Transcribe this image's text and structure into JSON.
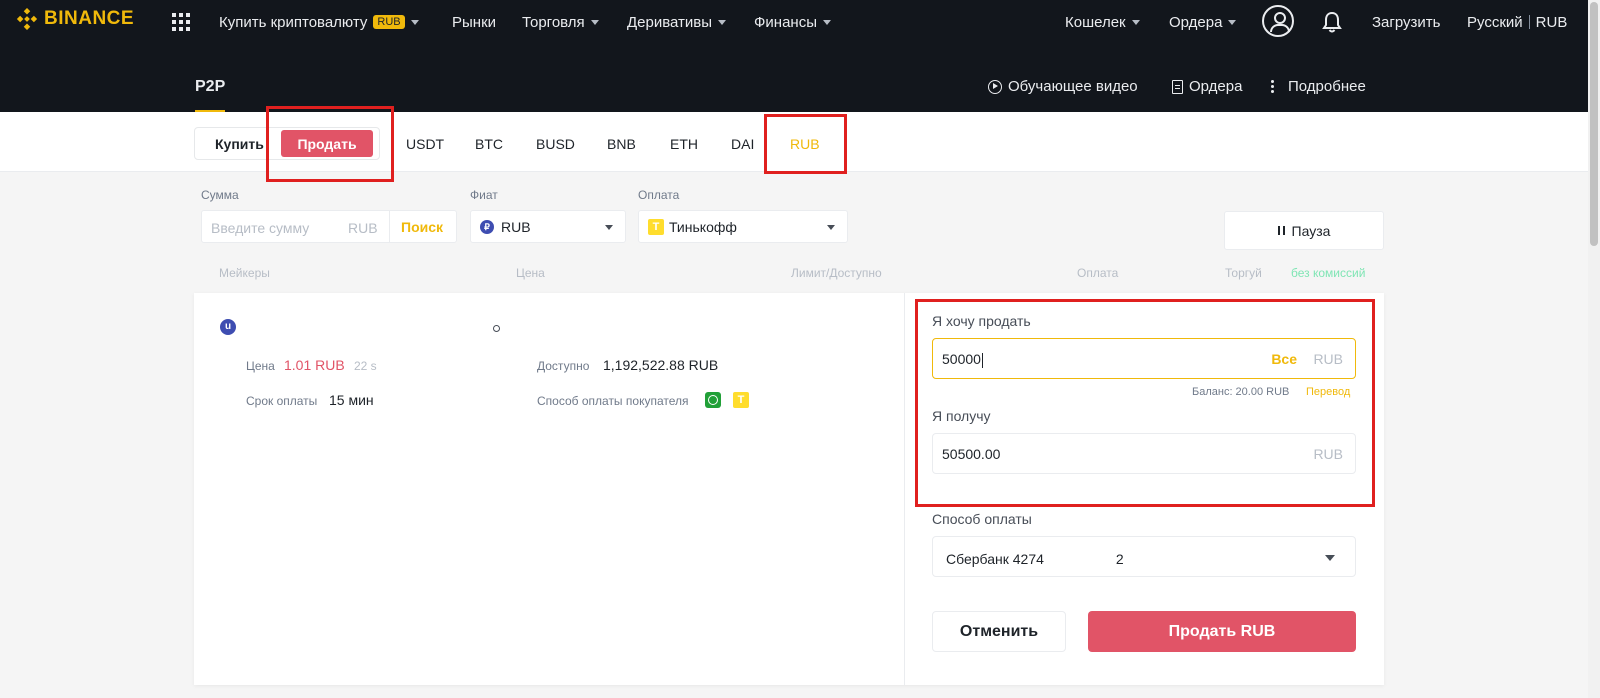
{
  "topnav": {
    "logo_text": "BINANCE",
    "items": [
      {
        "label": "Купить криптовалюту",
        "badge": "RUB"
      },
      {
        "label": "Рынки"
      },
      {
        "label": "Торговля"
      },
      {
        "label": "Деривативы"
      },
      {
        "label": "Финансы"
      }
    ],
    "right": {
      "wallet": "Кошелек",
      "orders": "Ордера",
      "download": "Загрузить",
      "language": "Русский",
      "currency": "RUB"
    }
  },
  "subheader": {
    "title": "P2P",
    "video": "Обучающее видео",
    "orders": "Ордера",
    "more": "Подробнее"
  },
  "tabs": {
    "buy": "Купить",
    "sell": "Продать",
    "assets": [
      "USDT",
      "BTC",
      "BUSD",
      "BNB",
      "ETH",
      "DAI",
      "RUB"
    ],
    "active_asset": "RUB"
  },
  "filters": {
    "amount_label": "Сумма",
    "amount_placeholder": "Введите сумму",
    "amount_unit": "RUB",
    "search": "Поиск",
    "fiat_label": "Фиат",
    "fiat_value": "RUB",
    "fiat_icon": "₽",
    "payment_label": "Оплата",
    "payment_value": "Тинькофф",
    "payment_icon": "T",
    "pause": "Пауза"
  },
  "columns": {
    "makers": "Мейкеры",
    "price": "Цена",
    "limit": "Лимит/Доступно",
    "payment": "Оплата",
    "trade": "Торгуй",
    "no_fee": "без комиссий"
  },
  "order": {
    "avatar_letter": "u",
    "price_label": "Цена",
    "price_value": "1.01 RUB",
    "price_timer": "22 s",
    "term_label": "Срок оплаты",
    "term_value": "15 мин",
    "available_label": "Доступно",
    "available_value": "1,192,522.88 RUB",
    "buyer_pay_label": "Способ оплаты покупателя",
    "buyer_pay_icons": [
      "sberbank-icon",
      "tinkoff-icon"
    ],
    "buyer_pay_icon_glyph": "T"
  },
  "sell_form": {
    "want_sell_label": "Я хочу продать",
    "want_sell_value": "50000",
    "all_label": "Все",
    "unit": "RUB",
    "balance": "Баланс: 20.00 RUB",
    "transfer": "Перевод",
    "receive_label": "Я получу",
    "receive_value": "50500.00",
    "pay_method_label": "Способ оплаты",
    "pay_method_value": "Сбербанк 4274",
    "pay_method_suffix": "2",
    "cancel": "Отменить",
    "submit": "Продать RUB"
  },
  "colors": {
    "brand": "#f0b90b",
    "sell": "#e15467",
    "nav_bg": "#12161c",
    "annotation": "#e0201f"
  }
}
